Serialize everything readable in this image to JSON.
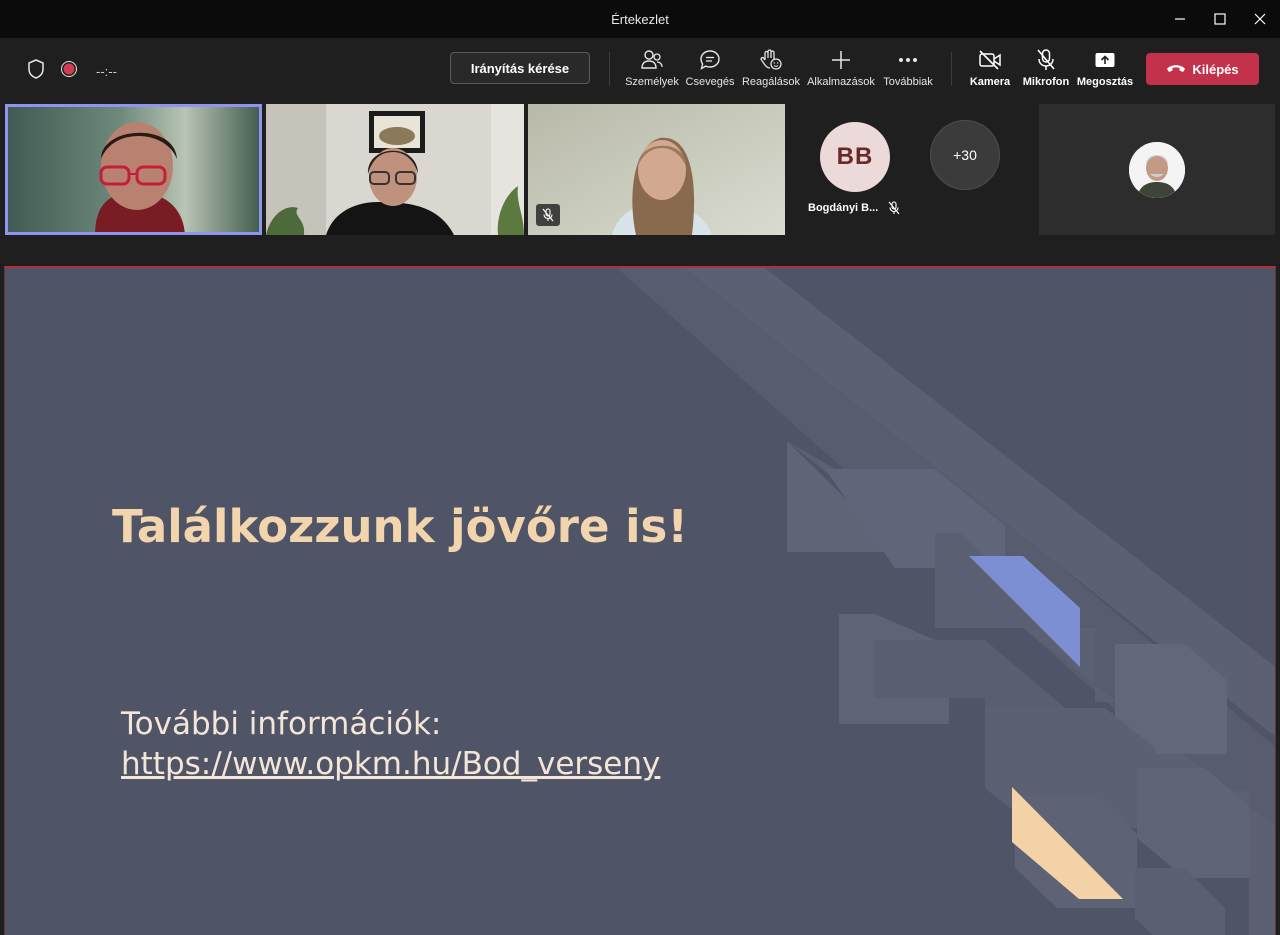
{
  "window": {
    "title": "Értekezlet"
  },
  "toolbar": {
    "timer": "--:--",
    "control_request": "Irányítás kérése",
    "people": "Személyek",
    "chat": "Csevegés",
    "reactions": "Reagálások",
    "apps": "Alkalmazások",
    "more": "Továbbiak",
    "camera": "Kamera",
    "mic": "Mikrofon",
    "share": "Megosztás",
    "leave": "Kilépés"
  },
  "participants": {
    "bb_initials": "BB",
    "bb_name": "Bogdányi B...",
    "overflow_count": "+30"
  },
  "slide": {
    "title": "Találkozzunk jövőre is!",
    "info_label": "További információk:",
    "link": "https://www.opkm.hu/Bod_verseny"
  },
  "colors": {
    "leave": "#c4314b",
    "active_speaker": "#8f94ee",
    "slide_bg": "#4f5466",
    "slide_title": "#f2d5ad"
  }
}
